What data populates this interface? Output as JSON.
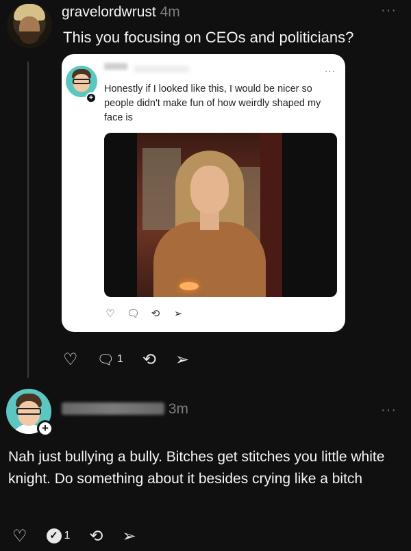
{
  "post": {
    "username": "gravelordwrust",
    "time": "4m",
    "more": "···",
    "text": "This you focusing on CEOs and politicians?",
    "actions": {
      "like_icon": "♡",
      "reply_icon": "🗨",
      "reply_count": "1",
      "repost_icon": "⟲",
      "share_icon": "➢"
    }
  },
  "quoted": {
    "plus": "+",
    "more": "···",
    "text": "Honestly if I looked like this, I would be nicer so people didn't make fun of how weirdly shaped my face is",
    "actions": {
      "like_icon": "♡",
      "reply_icon": "🗨",
      "repost_icon": "⟲",
      "share_icon": "➢"
    }
  },
  "reply": {
    "plus": "+",
    "time": "3m",
    "more": "···",
    "text": "Nah just bullying a bully. Bitches get stitches you little white knight. Do something about it besides crying like a bitch",
    "actions": {
      "like_icon": "♡",
      "reply_icon": "✓",
      "reply_count": "1",
      "repost_icon": "⟲",
      "share_icon": "➢"
    }
  }
}
